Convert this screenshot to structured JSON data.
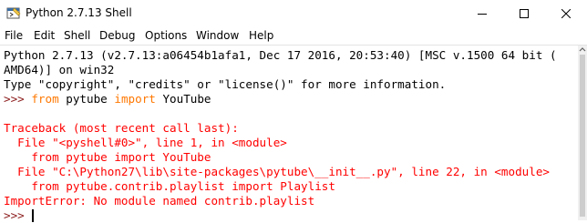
{
  "window": {
    "title": "Python 2.7.13 Shell"
  },
  "menu": {
    "items": [
      "File",
      "Edit",
      "Shell",
      "Debug",
      "Options",
      "Window",
      "Help"
    ]
  },
  "shell": {
    "banner_line1": "Python 2.7.13 (v2.7.13:a06454b1afa1, Dec 17 2016, 20:53:40) [MSC v.1500 64 bit (",
    "banner_line2": "AMD64)] on win32",
    "banner_line3": "Type \"copyright\", \"credits\" or \"license()\" for more information.",
    "prompt": ">>> ",
    "cmd_kw_from": "from",
    "cmd_module": " pytube ",
    "cmd_kw_import": "import",
    "cmd_name": " YouTube",
    "traceback": [
      "Traceback (most recent call last):",
      "  File \"<pyshell#0>\", line 1, in <module>",
      "    from pytube import YouTube",
      "  File \"C:\\Python27\\lib\\site-packages\\pytube\\__init__.py\", line 22, in <module>",
      "    from pytube.contrib.playlist import Playlist",
      "ImportError: No module named contrib.playlist"
    ],
    "final_prompt": ">>> "
  },
  "colors": {
    "keyword": "#ff7700",
    "prompt": "#8b1a1a",
    "error": "#ff0000"
  }
}
